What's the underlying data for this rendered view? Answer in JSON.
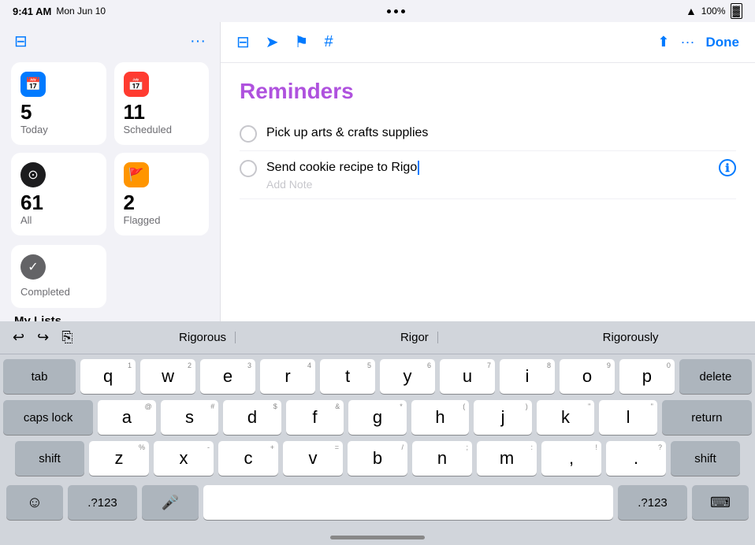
{
  "statusBar": {
    "time": "9:41 AM",
    "date": "Mon Jun 10",
    "wifi": "wifi",
    "battery": "100%"
  },
  "sidebar": {
    "smartLists": [
      {
        "id": "today",
        "label": "Today",
        "count": "5",
        "icon": "📅",
        "iconBg": "blue"
      },
      {
        "id": "scheduled",
        "label": "Scheduled",
        "count": "11",
        "icon": "📅",
        "iconBg": "red"
      },
      {
        "id": "all",
        "label": "All",
        "count": "61",
        "icon": "⚫",
        "iconBg": "dark"
      },
      {
        "id": "flagged",
        "label": "Flagged",
        "count": "2",
        "icon": "🚩",
        "iconBg": "orange"
      }
    ],
    "completed": {
      "label": "Completed",
      "icon": "✓"
    },
    "myListsHeader": "My Lists"
  },
  "toolbar": {
    "icons": [
      "camera",
      "location",
      "flag",
      "tag"
    ],
    "share": "share",
    "more": "more",
    "doneLabel": "Done"
  },
  "main": {
    "listTitle": "Reminders",
    "reminders": [
      {
        "id": 1,
        "text": "Pick up arts & crafts supplies",
        "addNote": null,
        "hasInfo": false
      },
      {
        "id": 2,
        "text": "Send cookie recipe to Rigo",
        "addNote": "Add Note",
        "hasInfo": true
      }
    ]
  },
  "predictive": {
    "suggestions": [
      "Rigorous",
      "Rigor",
      "Rigorously"
    ]
  },
  "keyboard": {
    "row1": [
      "q",
      "w",
      "e",
      "r",
      "t",
      "y",
      "u",
      "i",
      "o",
      "p"
    ],
    "row1nums": [
      "1",
      "2",
      "3",
      "4",
      "5",
      "6",
      "7",
      "8",
      "9",
      "0"
    ],
    "row2": [
      "a",
      "s",
      "d",
      "f",
      "g",
      "h",
      "j",
      "k",
      "l"
    ],
    "row2nums": [
      "@",
      "#",
      "$",
      "&",
      "*",
      "(",
      ")",
      "“",
      "”"
    ],
    "row3": [
      "z",
      "x",
      "c",
      "v",
      "b",
      "n",
      "m",
      ",",
      "."
    ],
    "row3nums": [
      "%",
      "-",
      "+",
      "=",
      "/",
      ";",
      ":",
      "!",
      "?"
    ],
    "specialKeys": {
      "tab": "tab",
      "delete": "delete",
      "capsLock": "caps lock",
      "return": "return",
      "shiftLeft": "shift",
      "shiftRight": "shift",
      "emoji": "☺",
      "numbers": ".?123",
      "mic": "🎤",
      "space": "",
      "numbersRight": ".?123",
      "hideKeyboard": "⌨"
    }
  }
}
